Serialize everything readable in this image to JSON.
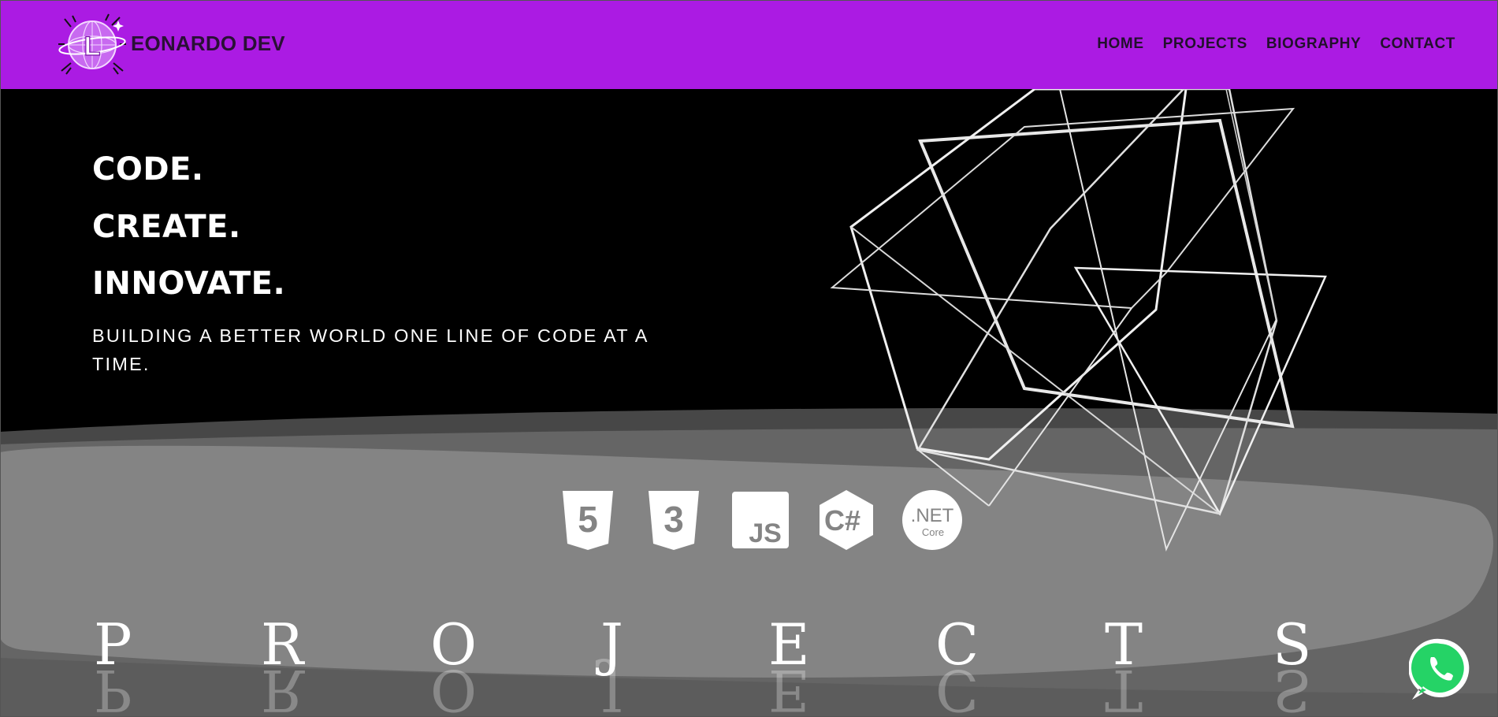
{
  "header": {
    "brand": "EONARDO DEV",
    "logo_letter": "L",
    "nav": [
      "HOME",
      "PROJECTS",
      "BIOGRAPHY",
      "CONTACT"
    ]
  },
  "hero": {
    "line1": "CODE.",
    "line2": "CREATE.",
    "line3": "INNOVATE.",
    "tagline": "BUILDING A BETTER WORLD ONE LINE OF CODE AT A TIME."
  },
  "tech_icons": [
    {
      "name": "html5-icon",
      "label": "5"
    },
    {
      "name": "css3-icon",
      "label": "3"
    },
    {
      "name": "javascript-icon",
      "label": "JS"
    },
    {
      "name": "csharp-icon",
      "label": "C#"
    },
    {
      "name": "dotnet-core-icon",
      "label": ".NET",
      "sub": "Core"
    }
  ],
  "projects_title": [
    "P",
    "R",
    "O",
    "J",
    "E",
    "C",
    "T",
    "S"
  ],
  "colors": {
    "header_bg": "#ab1be3",
    "hero_bg": "#000000",
    "wave_dark": "#4a4a4a",
    "wave_mid": "#676767",
    "wave_light": "#858585",
    "whatsapp": "#25d366"
  },
  "floating_action": {
    "icon": "whatsapp-icon"
  }
}
